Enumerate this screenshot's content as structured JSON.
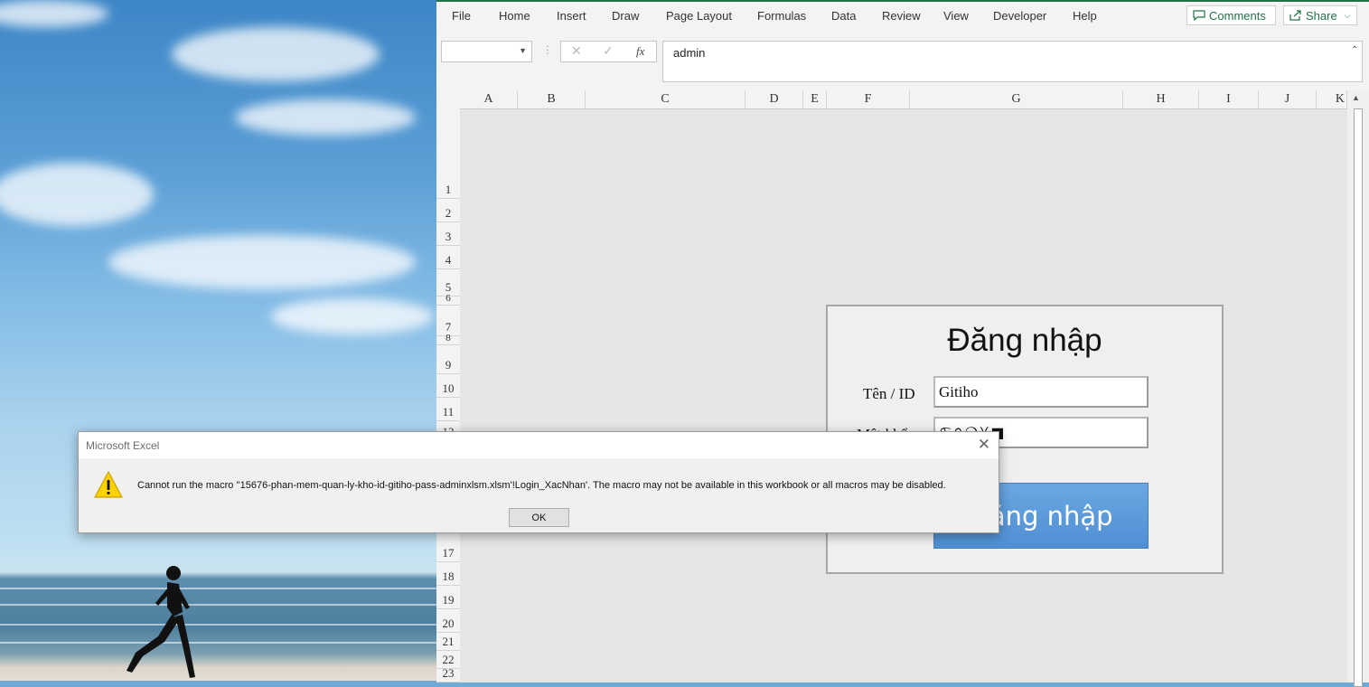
{
  "excel": {
    "menu": [
      "File",
      "Home",
      "Insert",
      "Draw",
      "Page Layout",
      "Formulas",
      "Data",
      "Review",
      "View",
      "Developer",
      "Help"
    ],
    "comments_label": "Comments",
    "share_label": "Share",
    "formula_bar": {
      "name_box_value": "",
      "fx_label": "fx",
      "formula_value": "admin"
    },
    "columns": [
      "A",
      "B",
      "C",
      "D",
      "E",
      "F",
      "G",
      "H",
      "I",
      "J",
      "K"
    ],
    "rows": [
      "1",
      "2",
      "3",
      "4",
      "5",
      "6",
      "7",
      "8",
      "9",
      "10",
      "11",
      "12",
      "17",
      "18",
      "19",
      "20",
      "21",
      "22",
      "23"
    ]
  },
  "login_form": {
    "title": "Đăng nhập",
    "username_label": "Tên / ID",
    "username_value": "Gitiho",
    "password_label": "Mật khẩu",
    "password_value": "♋♎❍♓■",
    "button_label": "Đăng nhập"
  },
  "dialog": {
    "title": "Microsoft Excel",
    "message": "Cannot run the macro ''15676-phan-mem-quan-ly-kho-id-gitiho-pass-adminxlsm.xlsm'!Login_XacNhan'. The macro may not be available in this workbook or all macros may be disabled.",
    "ok_label": "OK"
  }
}
